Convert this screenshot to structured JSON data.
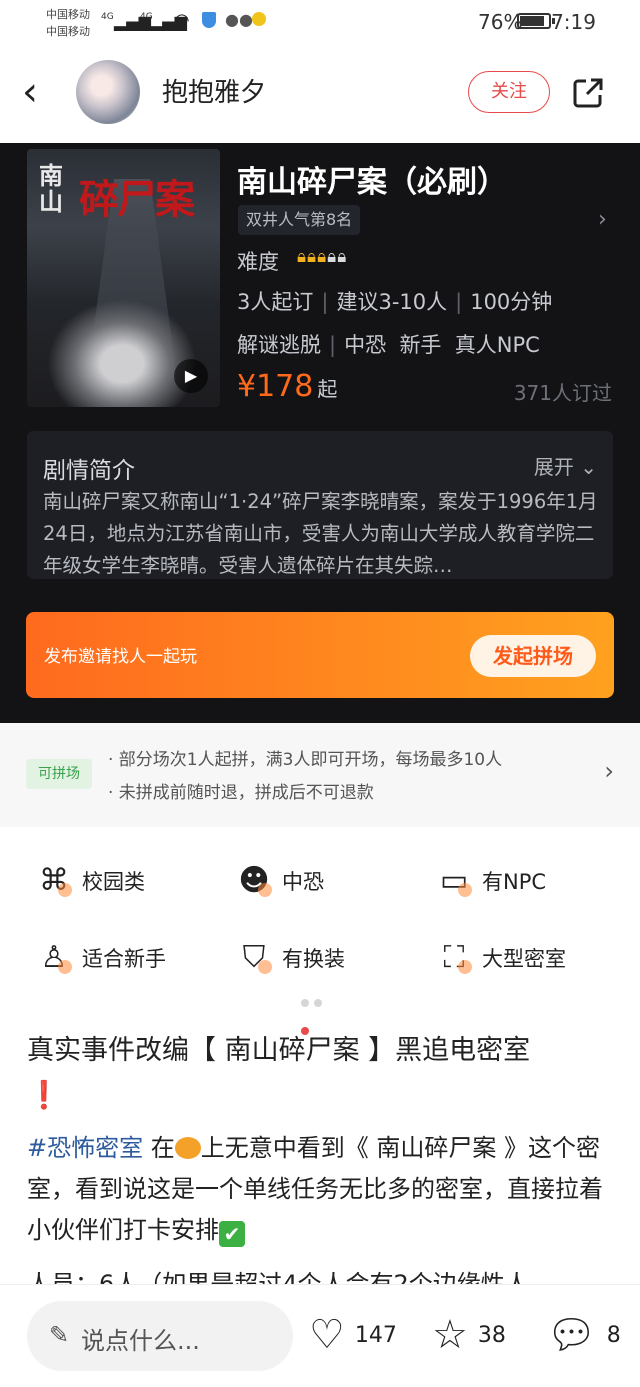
{
  "status_bar": {
    "carrier_1": "中国移动",
    "carrier_2": "中国移动",
    "signal_1": "4G",
    "signal_2": "4G",
    "battery": "76%",
    "time": "7:19"
  },
  "header": {
    "username": "抱抱雅夕",
    "follow_label": "关注"
  },
  "game": {
    "poster_title_small": "南山",
    "poster_title_big": "碎尸案",
    "title": "南山碎尸案（必刷）",
    "rank": "双井人气第8名",
    "difficulty_label": "难度",
    "difficulty_level": 3,
    "difficulty_max": 5,
    "players_min": "3人起订",
    "players_suggest": "建议3-10人",
    "duration": "100分钟",
    "tags_1": "解谜逃脱",
    "tags_2": "中恐",
    "tags_3": "新手",
    "tags_4": "真人NPC",
    "price": "¥178",
    "price_suffix": "起",
    "booked": "371人订过"
  },
  "plot": {
    "title": "剧情简介",
    "expand_label": "展开",
    "text": "南山碎尸案又称南山“1·24”碎尸案李晓晴案，案发于1996年1月24日，地点为江苏省南山市，受害人为南山大学成人教育学院二年级女学生李晓晴。受害人遗体碎片在其失踪…"
  },
  "invite": {
    "text": "发布邀请找人一起玩",
    "button": "发起拼场"
  },
  "group": {
    "badge": "可拼场",
    "line_1": "· 部分场次1人起拼，满3人即可开场，每场最多10人",
    "line_2": "· 未拼成前随时退，拼成后不可退款"
  },
  "feature_tags": [
    {
      "label": "校园类",
      "icon": "campus-icon"
    },
    {
      "label": "中恐",
      "icon": "skull-icon"
    },
    {
      "label": "有NPC",
      "icon": "monitor-icon"
    },
    {
      "label": "适合新手",
      "icon": "person-icon"
    },
    {
      "label": "有换装",
      "icon": "shirt-icon"
    },
    {
      "label": "大型密室",
      "icon": "room-icon"
    }
  ],
  "post": {
    "title": "真实事件改编【 南山碎尸案 】黑追电密室",
    "title_mark": "❗",
    "hashtag": "#恐怖密室",
    "body_1": " 在",
    "body_2": "上无意中看到《 南山碎尸案 》这个密室，看到说这是一个单线任务无比多的密室，直接拉着小伙伴们打卡安排",
    "body_check": "✔",
    "cut_line": "人员：6人（如果是超过4个人会有2个边缘性人"
  },
  "bottom_bar": {
    "comment_placeholder": "说点什么...",
    "likes": "147",
    "stars": "38",
    "comments": "8"
  }
}
